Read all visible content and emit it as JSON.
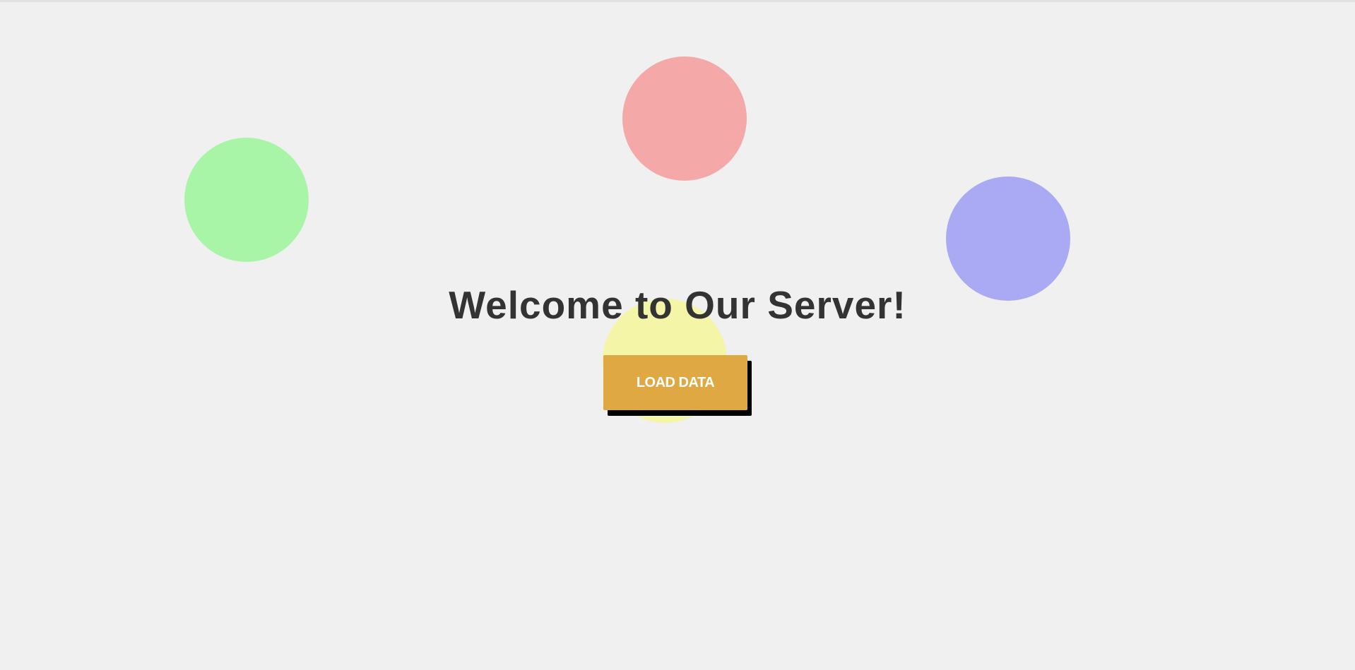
{
  "page": {
    "title": "Welcome to Our Server!",
    "background_color": "#f0f0f0"
  },
  "button": {
    "label": "LOAD DATA",
    "color": "#dfa843",
    "text_color": "#ffffff",
    "shadow_color": "#000000"
  },
  "decorations": {
    "circles": [
      {
        "name": "red-circle",
        "color": "#f5a8a8"
      },
      {
        "name": "green-circle",
        "color": "#a9f5a7"
      },
      {
        "name": "blue-circle",
        "color": "#aaa9f4"
      },
      {
        "name": "yellow-circle",
        "color": "#f5f5a8"
      }
    ]
  }
}
